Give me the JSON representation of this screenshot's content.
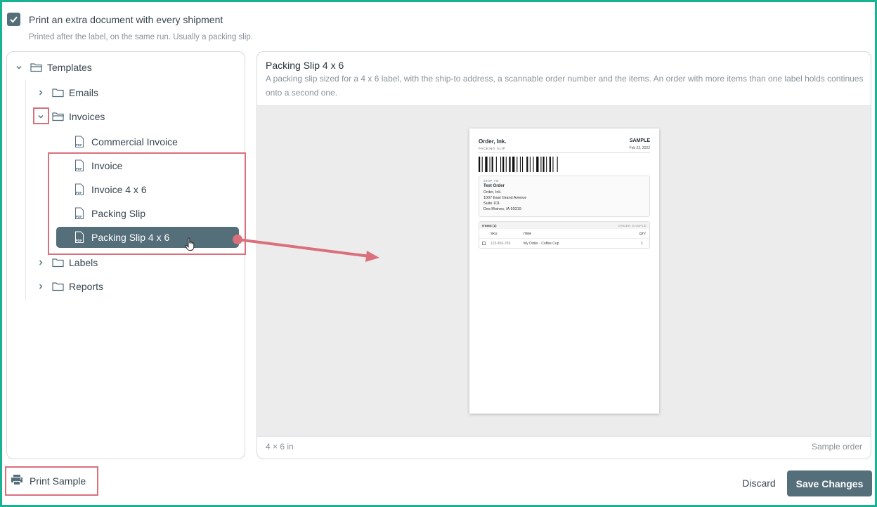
{
  "option": {
    "label": "Print an extra document with every shipment",
    "help": "Printed after the label, on the same run. Usually a packing slip.",
    "checked": true
  },
  "tree": {
    "root": "Templates",
    "folders": {
      "emails": "Emails",
      "invoices": "Invoices",
      "labels": "Labels",
      "reports": "Reports"
    },
    "files": [
      "Commercial Invoice",
      "Invoice",
      "Invoice 4 x 6",
      "Packing Slip",
      "Packing Slip 4 x 6"
    ],
    "selected_file": "Packing Slip 4 x 6"
  },
  "preview": {
    "title": "Packing Slip 4 x 6",
    "description": "A packing slip sized for a 4 x 6 label, with the ship-to address, a scannable order number and the items. An order with more items than one label holds continues onto a second one.",
    "size": "4 × 6 in",
    "source": "Sample order",
    "slip": {
      "company": "Order, Ink.",
      "subtitle": "PACKING SLIP",
      "badge": "SAMPLE",
      "date": "Feb 22, 2022",
      "ship_to_label": "SHIP TO",
      "ship_to_name": "Test Order",
      "ship_lines": [
        "Order, Ink.",
        "1007 East Grand Avenue",
        "Suite 101",
        "Des Moines, IA 50319"
      ],
      "items_title": "ITEMS (1)",
      "items_note": "ORDER SAMPLE",
      "columns": {
        "sku": "SKU",
        "item": "ITEM",
        "qty": "QTY"
      },
      "row": {
        "sku": "123-456-789",
        "item": "My Order - Coffee Cup",
        "qty": "1"
      }
    }
  },
  "actions": {
    "print_sample": "Print Sample",
    "discard": "Discard",
    "save": "Save Changes"
  },
  "colors": {
    "accent": "#546e7a",
    "frame": "#17b392",
    "annotation": "#d9707b"
  },
  "icons": {
    "checkbox": "check-icon",
    "folder": "folder-icon",
    "file": "pdf-file-icon",
    "printer": "printer-icon",
    "cursor": "hand-cursor-icon"
  }
}
